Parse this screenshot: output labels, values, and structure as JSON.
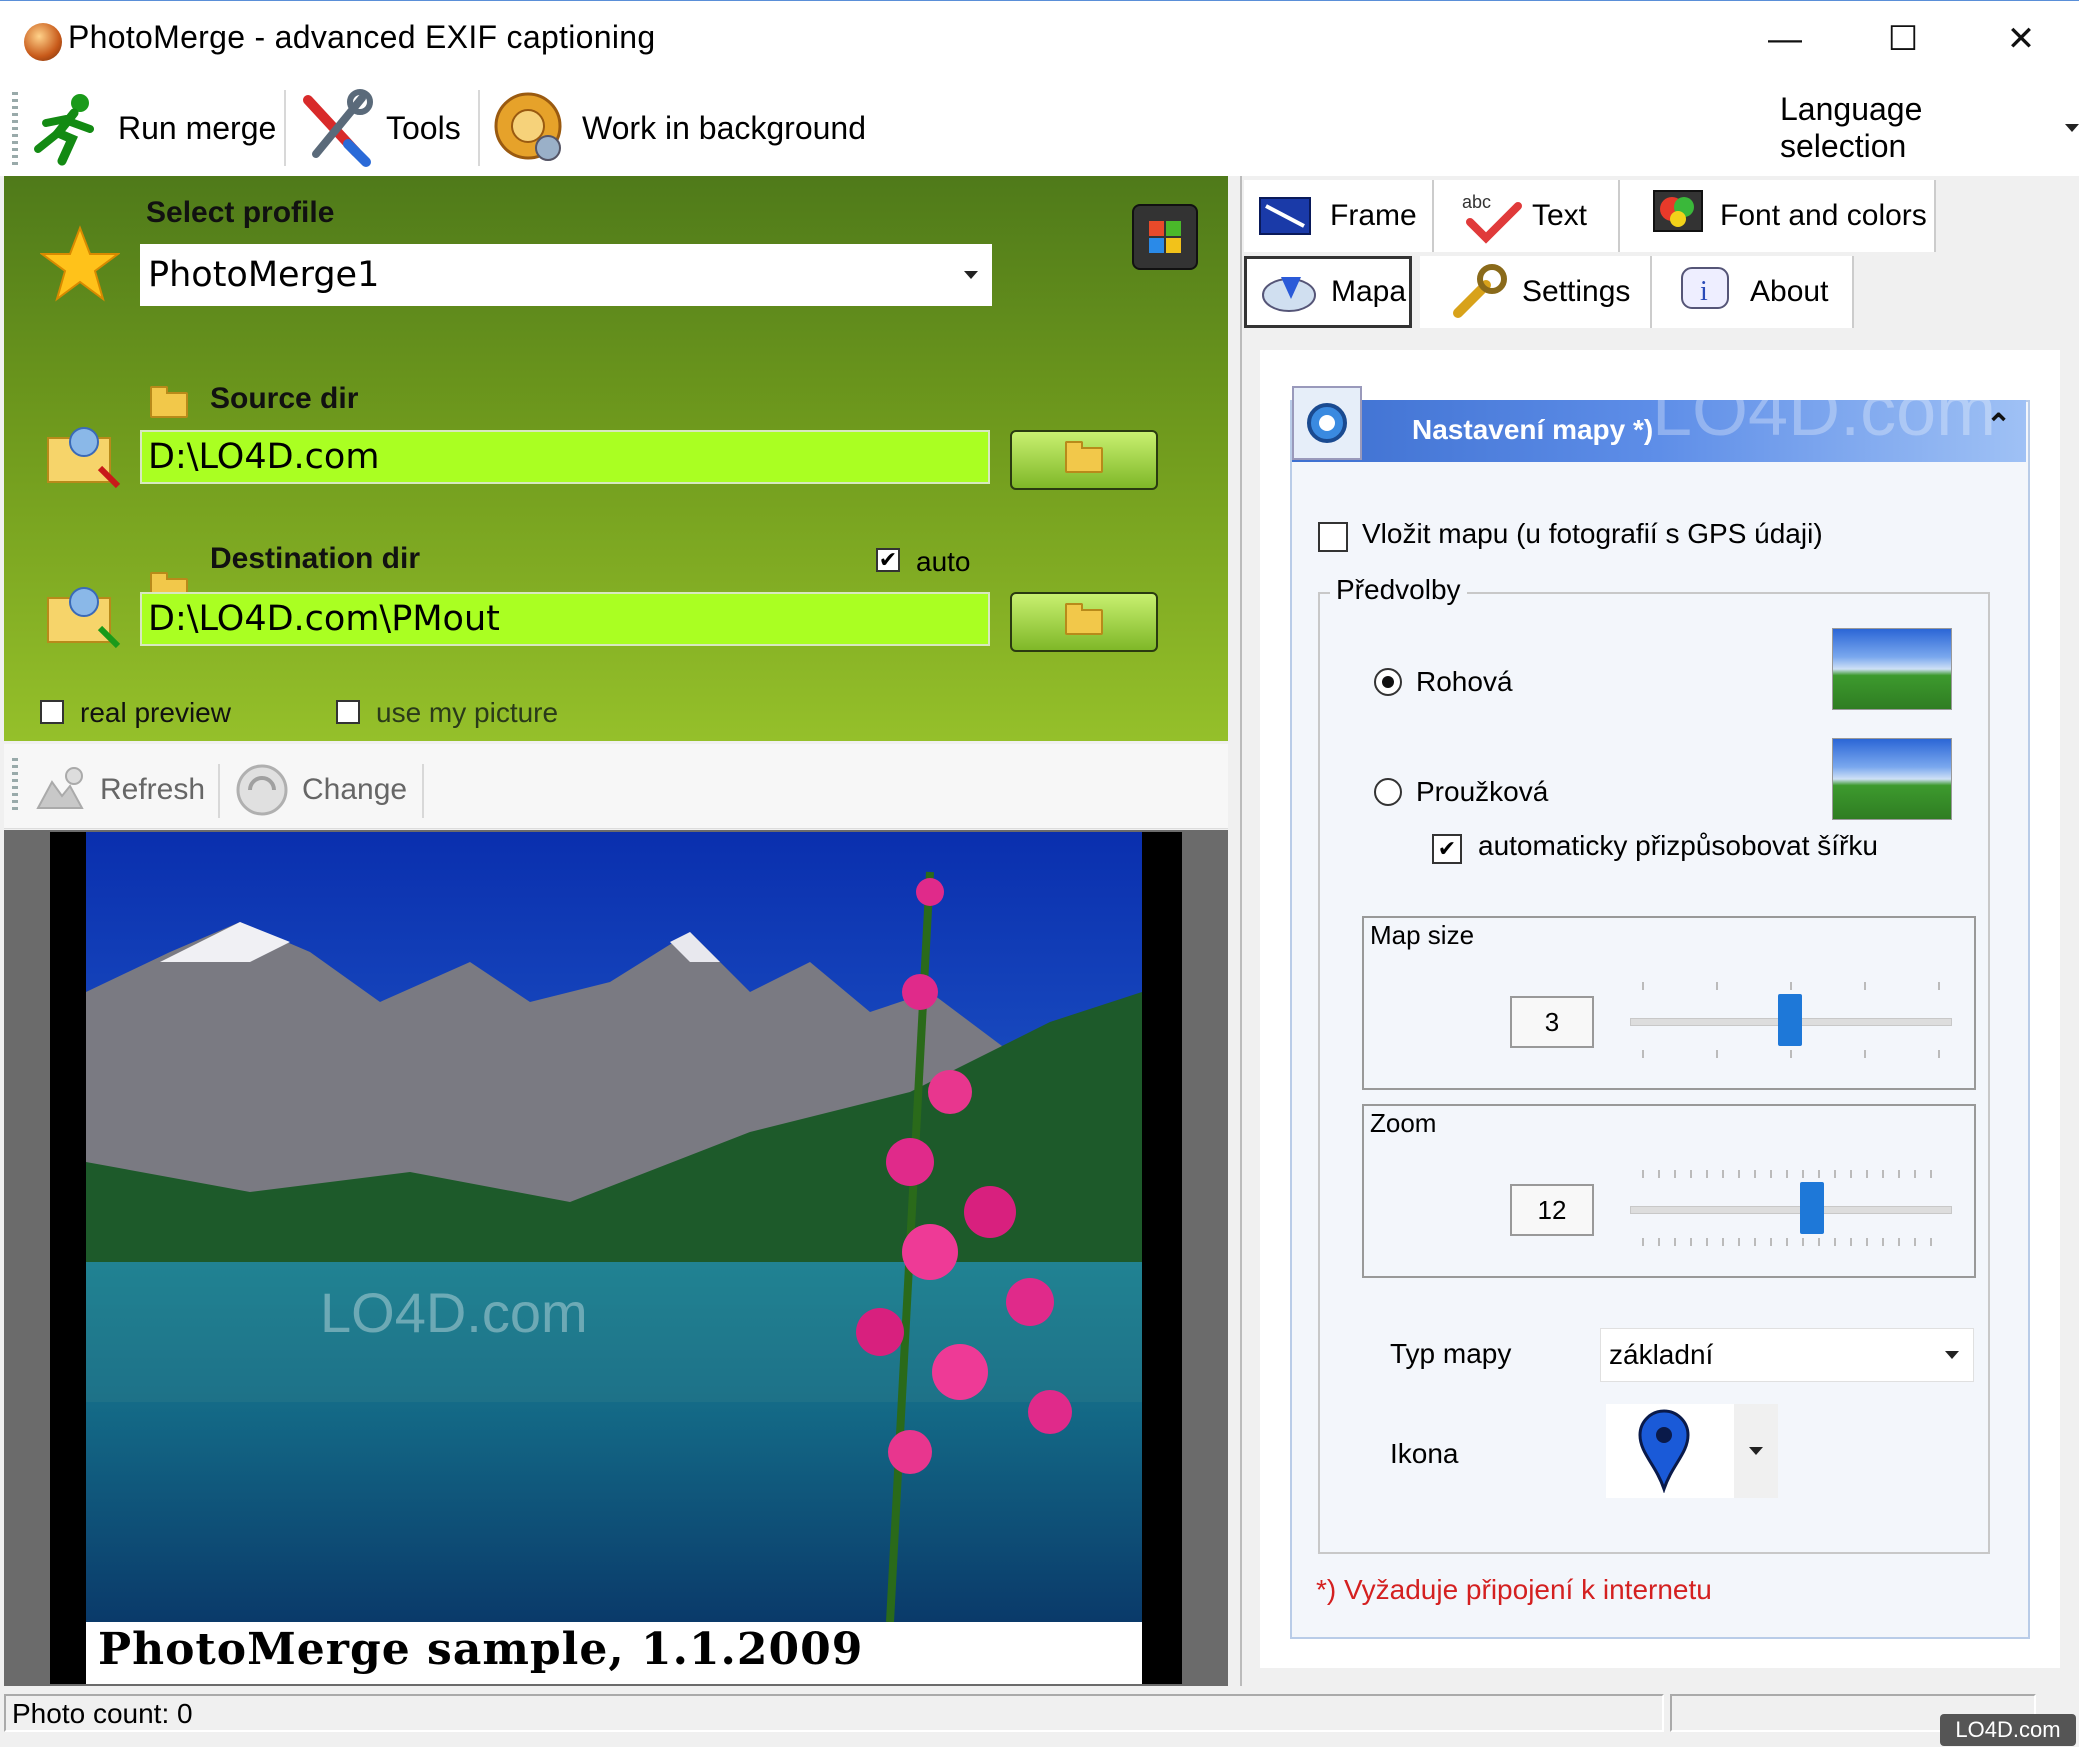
{
  "window": {
    "title": "PhotoMerge - advanced EXIF captioning",
    "controls": [
      "—",
      "☐",
      "✕"
    ]
  },
  "toolbar": {
    "run_merge": "Run merge",
    "tools": "Tools",
    "work_in_background": "Work in background",
    "language_selection": "Language selection"
  },
  "left": {
    "select_profile_label": "Select profile",
    "profile_value": "PhotoMerge1",
    "source_dir_label": "Source dir",
    "source_dir_value": "D:\\LO4D.com",
    "destination_dir_label": "Destination dir",
    "auto_label": "auto",
    "auto_checked": true,
    "destination_dir_value": "D:\\LO4D.com\\PMout",
    "real_preview_label": "real preview",
    "use_my_picture_label": "use my picture"
  },
  "preview_toolbar": {
    "refresh": "Refresh",
    "change": "Change"
  },
  "preview": {
    "caption": "PhotoMerge sample, 1.1.2009",
    "watermark": "LO4D.com"
  },
  "tabs": {
    "row1": [
      {
        "label": "Frame",
        "icon": "frame-icon"
      },
      {
        "label": "Text",
        "icon": "text-icon"
      },
      {
        "label": "Font and colors",
        "icon": "palette-icon"
      }
    ],
    "row2": [
      {
        "label": "Mapa",
        "icon": "map-icon",
        "active": true
      },
      {
        "label": "Settings",
        "icon": "wrench-icon"
      },
      {
        "label": "About",
        "icon": "info-icon"
      }
    ]
  },
  "map_settings": {
    "header": "Nastavení mapy *)",
    "insert_map_label": "Vložit mapu (u fotografií s GPS údaji)",
    "insert_map_checked": false,
    "presets_label": "Předvolby",
    "corner_label": "Rohová",
    "corner_selected": true,
    "strip_label": "Proužková",
    "strip_selected": false,
    "auto_width_label": "automaticky přizpůsobovat šířku",
    "auto_width_checked": true,
    "map_size_label": "Map size",
    "map_size_value": "3",
    "map_size_level": 0.5,
    "zoom_label": "Zoom",
    "zoom_value": "12",
    "zoom_level": 0.6,
    "map_type_label": "Typ mapy",
    "map_type_value": "základní",
    "icon_label": "Ikona",
    "footnote": "*) Vyžaduje připojení k internetu",
    "watermark": "LO4D.com"
  },
  "statusbar": {
    "photo_count": "Photo count: 0",
    "watermark": "LO4D.com"
  },
  "colors": {
    "accent_green": "#aaff22",
    "header_blue": "#3d6fd0",
    "slider_blue": "#1e78d8",
    "footnote_red": "#d42020"
  }
}
